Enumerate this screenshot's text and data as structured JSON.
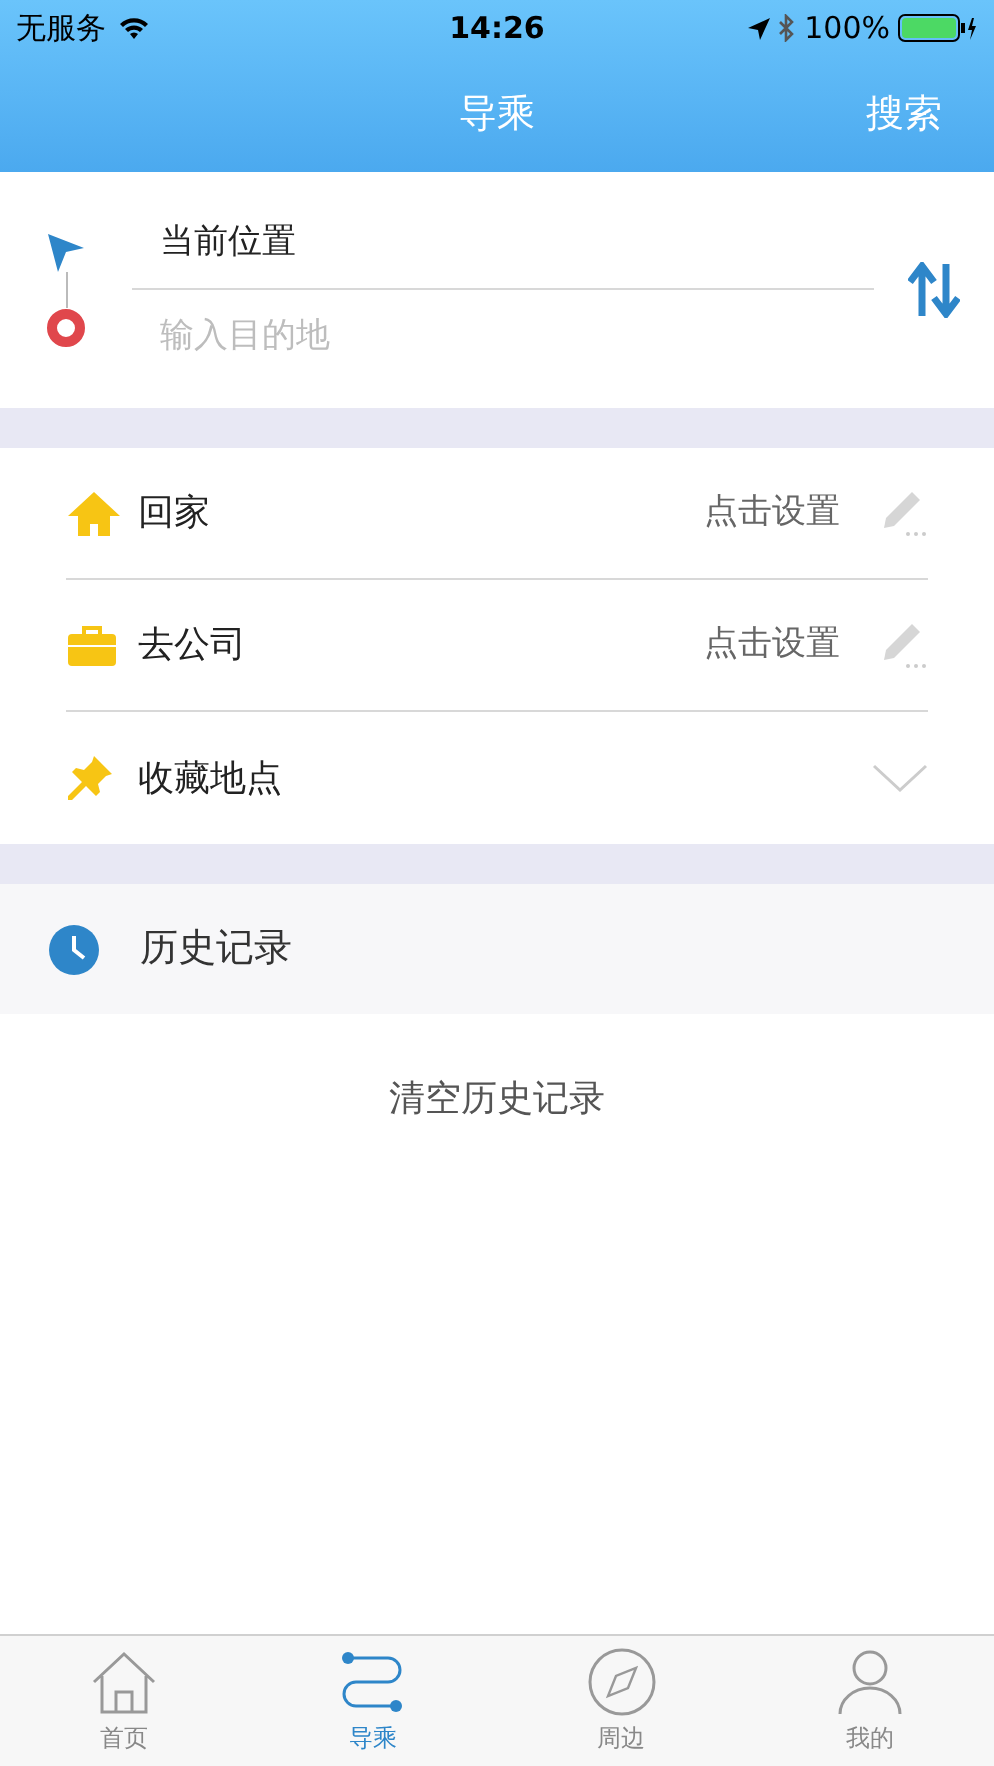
{
  "status_bar": {
    "carrier": "无服务",
    "time": "14:26",
    "battery": "100%"
  },
  "nav": {
    "title": "导乘",
    "action": "搜索"
  },
  "route": {
    "origin": "当前位置",
    "destination_placeholder": "输入目的地"
  },
  "places": [
    {
      "kind": "home",
      "label": "回家",
      "hint": "点击设置"
    },
    {
      "kind": "work",
      "label": "去公司",
      "hint": "点击设置"
    },
    {
      "kind": "favorites",
      "label": "收藏地点",
      "expanded": false
    }
  ],
  "history": {
    "title": "历史记录",
    "clear": "清空历史记录"
  },
  "tabs": [
    {
      "kind": "home",
      "label": "首页",
      "selected": false
    },
    {
      "kind": "route",
      "label": "导乘",
      "selected": true
    },
    {
      "kind": "compass",
      "label": "周边",
      "selected": false
    },
    {
      "kind": "user",
      "label": "我的",
      "selected": false
    }
  ]
}
